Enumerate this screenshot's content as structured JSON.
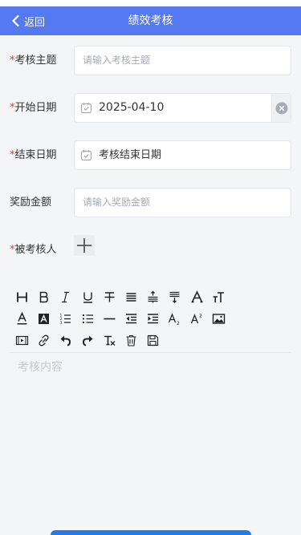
{
  "nav": {
    "back_label": "返回",
    "title": "绩效考核"
  },
  "form": {
    "topic": {
      "label": "考核主题",
      "required_mark": "*",
      "placeholder": "请输入考核主题"
    },
    "start_date": {
      "label": "开始日期",
      "required_mark": "*",
      "value": "2025-04-10"
    },
    "end_date": {
      "label": "结束日期",
      "required_mark": "*",
      "placeholder": "考核结束日期"
    },
    "reward": {
      "label": "奖励金额",
      "placeholder": "请输入奖励金额"
    },
    "assessee": {
      "label": "被考核人",
      "required_mark": "*"
    }
  },
  "editor": {
    "toolbar_rows": [
      [
        "heading-icon",
        "bold-icon",
        "italic-icon",
        "underline-icon",
        "strikethrough-icon",
        "align-justify-icon",
        "line-height-icon",
        "paragraph-spacing-icon",
        "font-family-icon",
        "font-size-icon"
      ],
      [
        "font-color-icon",
        "background-color-icon",
        "ordered-list-icon",
        "unordered-list-icon",
        "horizontal-rule-icon",
        "outdent-icon",
        "indent-icon",
        "subscript-icon",
        "superscript-icon",
        "image-icon"
      ],
      [
        "video-icon",
        "link-icon",
        "undo-icon",
        "redo-icon",
        "clear-format-icon",
        "delete-icon",
        "save-icon"
      ]
    ],
    "placeholder": "考核内容"
  },
  "colors": {
    "nav_bg": "#5579f0",
    "required": "#e53935",
    "submit": "#1f7cf0"
  }
}
